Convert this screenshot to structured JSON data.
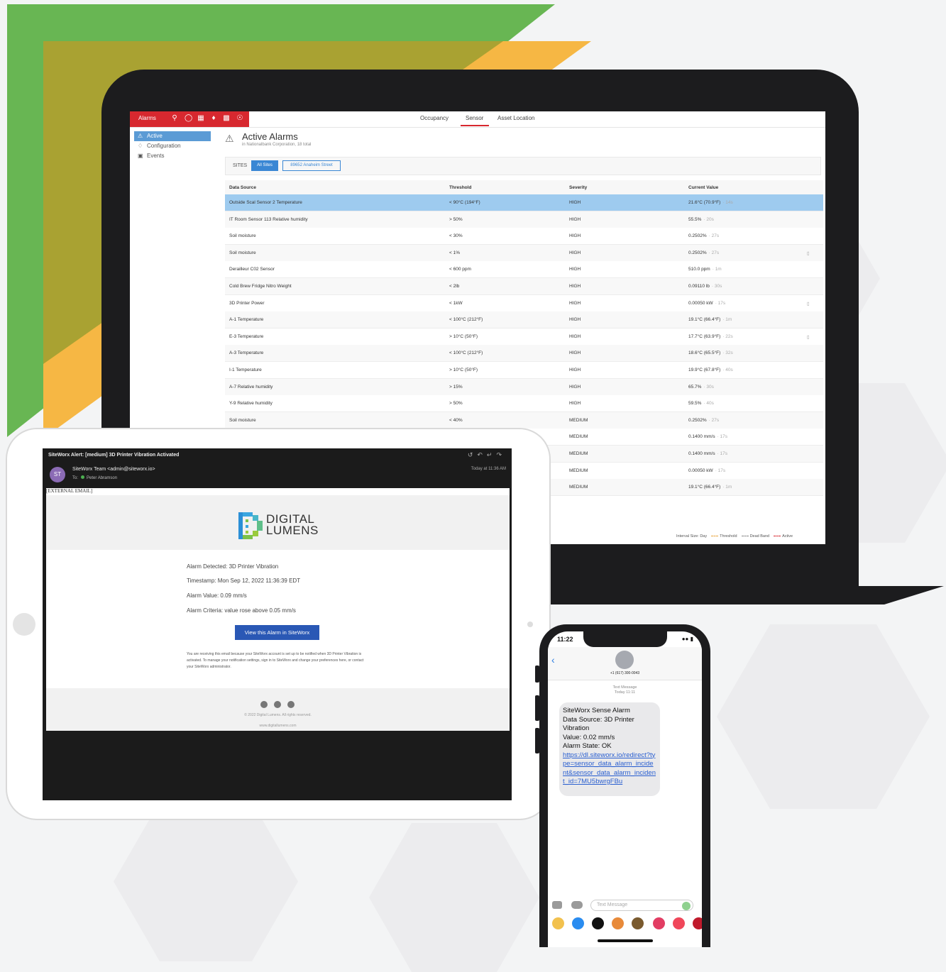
{
  "colors": {
    "green": "#68b653",
    "olive": "#a9a232",
    "orange": "#f6b744",
    "alarm_red": "#d7282f",
    "selected_row": "#9ecbef",
    "button_blue": "#2a58b5"
  },
  "dashboard": {
    "alarm_bar": {
      "label": "Alarms",
      "icons": [
        "location-pin-icon",
        "user-pin-icon",
        "building-icon",
        "bell-icon",
        "chart-icon",
        "hand-icon"
      ]
    },
    "nav_tabs": [
      "Occupancy",
      "Sensor",
      "Asset Location"
    ],
    "sidebar": [
      {
        "label": "Active",
        "icon": "alarm-icon"
      },
      {
        "label": "Configuration",
        "icon": "bell-icon"
      },
      {
        "label": "Events",
        "icon": "calendar-icon"
      }
    ],
    "title": "Active Alarms",
    "subtitle": "in Nationalbank Corporation, 18 total",
    "sites_label": "SITES",
    "site_all": "All Sites",
    "site_one": "89652 Anaheim Street",
    "columns": [
      "Data Source",
      "Threshold",
      "Severity",
      "Current Value"
    ],
    "rows": [
      {
        "source": "Outside Scal Sensor 2 Temperature",
        "threshold": "< 90°C (194°F)",
        "severity": "HIGH",
        "value": "21.6°C (70.9°F)",
        "ago": "· 14s",
        "doc": false
      },
      {
        "source": "IT Room Sensor 113 Relative humidity",
        "threshold": "> 50%",
        "severity": "HIGH",
        "value": "55.5%",
        "ago": "· 20s",
        "doc": false
      },
      {
        "source": "Soil moisture",
        "threshold": "< 30%",
        "severity": "HIGH",
        "value": "0.2502%",
        "ago": "· 27s",
        "doc": false
      },
      {
        "source": "Soil moisture",
        "threshold": "< 1%",
        "severity": "HIGH",
        "value": "0.2502%",
        "ago": "· 27s",
        "doc": true
      },
      {
        "source": "Derailleur C02 Sensor",
        "threshold": "< 600 ppm",
        "severity": "HIGH",
        "value": "510.0 ppm",
        "ago": "· 1m",
        "doc": false
      },
      {
        "source": "Cold Brew Fridge Nitro Weight",
        "threshold": "< 2lb",
        "severity": "HIGH",
        "value": "0.09110 lb",
        "ago": "· 30s",
        "doc": false
      },
      {
        "source": "3D Printer Power",
        "threshold": "< 1kW",
        "severity": "HIGH",
        "value": "0.00050 kW",
        "ago": "· 17s",
        "doc": true
      },
      {
        "source": "A-1 Temperature",
        "threshold": "< 100°C (212°F)",
        "severity": "HIGH",
        "value": "19.1°C (66.4°F)",
        "ago": "· 1m",
        "doc": false
      },
      {
        "source": "E-3 Temperature",
        "threshold": "> 10°C (50°F)",
        "severity": "HIGH",
        "value": "17.7°C (63.9°F)",
        "ago": "· 22s",
        "doc": true
      },
      {
        "source": "A-3 Temperature",
        "threshold": "< 100°C (212°F)",
        "severity": "HIGH",
        "value": "18.6°C (65.5°F)",
        "ago": "· 32s",
        "doc": false
      },
      {
        "source": "I-1 Temperature",
        "threshold": "> 10°C (50°F)",
        "severity": "HIGH",
        "value": "19.9°C (67.8°F)",
        "ago": "· 40s",
        "doc": false
      },
      {
        "source": "A-7 Relative humidity",
        "threshold": "> 15%",
        "severity": "HIGH",
        "value": "65.7%",
        "ago": "· 30s",
        "doc": false
      },
      {
        "source": "Y-9 Relative humidity",
        "threshold": "> 50%",
        "severity": "HIGH",
        "value": "59.5%",
        "ago": "· 40s",
        "doc": false
      },
      {
        "source": "Soil moisture",
        "threshold": "< 40%",
        "severity": "MEDIUM",
        "value": "0.2502%",
        "ago": "· 27s",
        "doc": false
      },
      {
        "source": "",
        "threshold": "",
        "severity": "MEDIUM",
        "value": "0.1400 mm/s",
        "ago": "· 17s",
        "doc": false
      },
      {
        "source": "",
        "threshold": "",
        "severity": "MEDIUM",
        "value": "0.1400 mm/s",
        "ago": "· 17s",
        "doc": false
      },
      {
        "source": "",
        "threshold": "",
        "severity": "MEDIUM",
        "value": "0.00050 kW",
        "ago": "· 17s",
        "doc": false
      },
      {
        "source": "",
        "threshold": "",
        "severity": "MEDIUM",
        "value": "19.1°C (66.4°F)",
        "ago": "· 1m",
        "doc": false
      }
    ],
    "legend": {
      "interval": "Interval Size: Day",
      "threshold": "Threshold",
      "dead_band": "Dead Band",
      "active": "Active"
    }
  },
  "email": {
    "subject": "SiteWorx Alert: [medium] 3D Printer Vibration Activated",
    "avatar_initials": "ST",
    "from": "SiteWorx Team <admin@siteworx.io>",
    "to_label": "To:",
    "to_name": "Peter Abramson",
    "time": "Today at 11:36 AM",
    "external": "[EXTERNAL EMAIL]",
    "logo_line1": "DIGITAL",
    "logo_line2": "LUMENS",
    "lines": [
      "Alarm Detected: 3D Printer Vibration",
      "Timestamp: Mon Sep 12, 2022 11:36:39 EDT",
      "Alarm Value: 0.09 mm/s",
      "Alarm Criteria: value rose above 0.05 mm/s"
    ],
    "button": "View this Alarm in SiteWorx",
    "note": "You are receiving this email because your SiteWorx account is set up to be notified when 3D Printer Vibration is activated. To manage your notification settings, sign in to SiteWorx and change your preferences here, or contact your SiteWorx administrator.",
    "copyright": "© 2022 Digital Lumens. All rights reserved.",
    "website": "www.digitallumens.com"
  },
  "phone": {
    "time": "11:22",
    "number": "+1 (617) 300-0043",
    "meta1": "Text Message",
    "meta2": "Today 11:11",
    "message": [
      "SiteWorx Sense Alarm",
      "Data Source: 3D Printer Vibration",
      "Value: 0.02 mm/s",
      "Alarm State: OK"
    ],
    "link": "https://dl.siteworx.io/redirect?type=sensor_data_alarm_incident&sensor_data_alarm_incident_id=7MU5bwrgFBu",
    "input_placeholder": "Text Message"
  }
}
